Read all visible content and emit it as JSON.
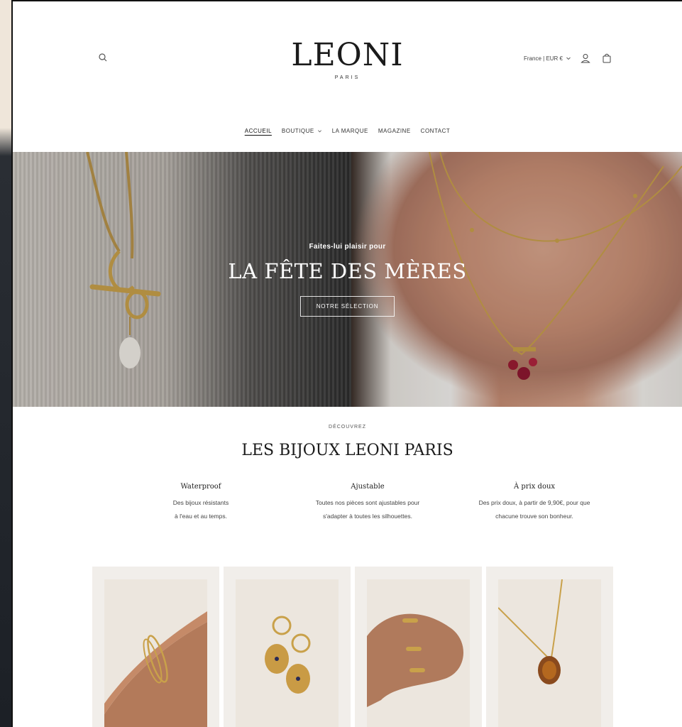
{
  "header": {
    "logo_main": "LEONI",
    "logo_sub": "PARIS",
    "locale": "France | EUR €",
    "icons": {
      "search": "search-icon",
      "account": "account-icon",
      "cart": "cart-icon"
    }
  },
  "nav": {
    "items": [
      {
        "label": "ACCUEIL",
        "active": true
      },
      {
        "label": "BOUTIQUE",
        "dropdown": true
      },
      {
        "label": "LA MARQUE"
      },
      {
        "label": "MAGAZINE"
      },
      {
        "label": "CONTACT"
      }
    ]
  },
  "hero": {
    "kicker": "Faites-lui plaisir pour",
    "title": "LA FÊTE DES MÈRES",
    "cta": "NOTRE SÉLECTION"
  },
  "discover": {
    "kicker": "DÉCOUVREZ",
    "title": "LES BIJOUX LEONI PARIS",
    "features": [
      {
        "title": "Waterproof",
        "line1": "Des bijoux résistants",
        "line2": "à l'eau et au temps."
      },
      {
        "title": "Ajustable",
        "line1": "Toutes nos pièces sont ajustables pour",
        "line2": "s'adapter à toutes les silhouettes."
      },
      {
        "title": "À prix doux",
        "line1": "Des prix doux, à partir de 9,90€, pour que",
        "line2": "chacune trouve son bonheur."
      }
    ]
  },
  "products": [
    {
      "name": "bracelet"
    },
    {
      "name": "earrings"
    },
    {
      "name": "rings"
    },
    {
      "name": "necklace"
    }
  ],
  "colors": {
    "text": "#1b1b1b",
    "card_bg": "#f1eeea",
    "gold": "#c9a14a"
  }
}
